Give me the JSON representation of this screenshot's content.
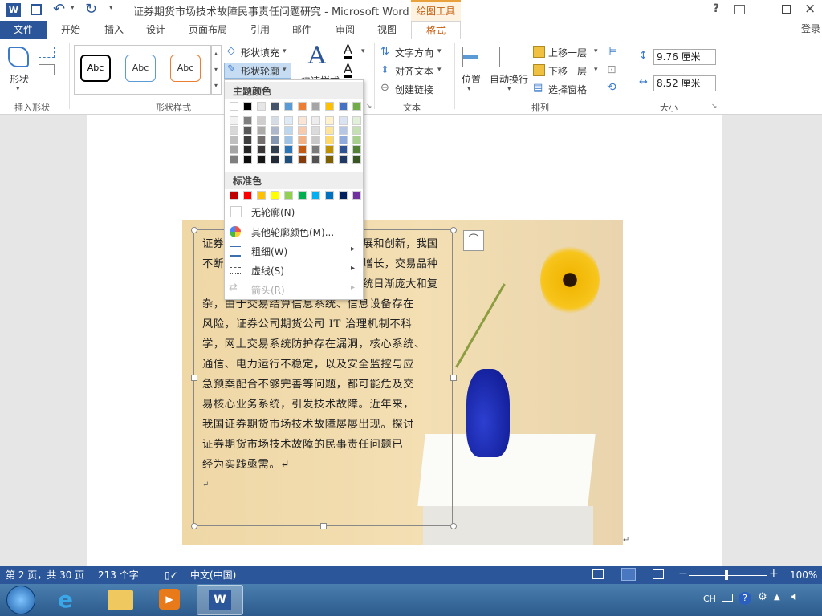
{
  "title": {
    "doc_title": "证券期货市场技术故障民事责任问题研究 - Microsoft Word",
    "context_tab": "绘图工具",
    "help": "?",
    "signin": "登录"
  },
  "tabs": [
    "文件",
    "开始",
    "插入",
    "设计",
    "页面布局",
    "引用",
    "邮件",
    "审阅",
    "视图",
    "格式"
  ],
  "ribbon": {
    "insert_shape": {
      "shape_label": "形状",
      "group": "插入形状"
    },
    "shape_styles": {
      "abc": [
        "Abc",
        "Abc",
        "Abc"
      ],
      "fill": "形状填充",
      "outline": "形状轮廓",
      "group": "形状样式"
    },
    "quick_styles": "快速样式",
    "text": {
      "direction": "文字方向",
      "align": "对齐文本",
      "link": "创建链接",
      "group": "文本"
    },
    "arrange": {
      "position": "位置",
      "wrap": "自动换行",
      "forward": "上移一层",
      "backward": "下移一层",
      "pane": "选择窗格",
      "group": "排列"
    },
    "size": {
      "height": "9.76 厘米",
      "width": "8.52 厘米",
      "group": "大小"
    }
  },
  "outline_menu": {
    "theme_colors_header": "主题颜色",
    "standard_colors_header": "标准色",
    "no_outline": "无轮廓(N)",
    "more_colors": "其他轮廓颜色(M)...",
    "weight": "粗细(W)",
    "dashes": "虚线(S)",
    "arrows": "箭头(R)",
    "theme_top_row": [
      "#ffffff",
      "#000000",
      "#e7e6e6",
      "#44546a",
      "#5b9bd5",
      "#ed7d31",
      "#a5a5a5",
      "#ffc000",
      "#4472c4",
      "#70ad47"
    ],
    "theme_shades": [
      [
        "#f2f2f2",
        "#7f7f7f",
        "#d0cece",
        "#d6dce4",
        "#deebf6",
        "#fbe5d5",
        "#ededed",
        "#fff2cc",
        "#dae3f3",
        "#e2efd9"
      ],
      [
        "#d8d8d8",
        "#595959",
        "#aeabab",
        "#adb9ca",
        "#bdd7ee",
        "#f8cbad",
        "#dbdbdb",
        "#fee599",
        "#b4c7e7",
        "#c5e0b3"
      ],
      [
        "#bfbfbf",
        "#3f3f3f",
        "#757070",
        "#8496b0",
        "#9dc3e6",
        "#f4b183",
        "#c9c9c9",
        "#ffd965",
        "#8faadc",
        "#a8d08d"
      ],
      [
        "#a5a5a5",
        "#262626",
        "#3a3838",
        "#323f4f",
        "#2e75b5",
        "#c55a11",
        "#7b7b7b",
        "#bf9000",
        "#2f5496",
        "#538135"
      ],
      [
        "#7f7f7f",
        "#0c0c0c",
        "#171616",
        "#222a35",
        "#1e4e79",
        "#843c0b",
        "#525252",
        "#7f6000",
        "#1f3864",
        "#375623"
      ]
    ],
    "standard": [
      "#c00000",
      "#ff0000",
      "#ffc000",
      "#ffff00",
      "#92d050",
      "#00b050",
      "#00b0f0",
      "#0070c0",
      "#002060",
      "#7030a0"
    ]
  },
  "document": {
    "partial_lines": [
      "展和创新，我国",
      "增长，交易品种",
      "统日渐庞大和复"
    ],
    "partial_prefix": [
      "证券",
      "不断"
    ],
    "lines": [
      "杂，由于交易结算信息系统、信息设备存在",
      "风险，证券公司期货公司 IT 治理机制不科",
      "学，网上交易系统防护存在漏洞，核心系统、",
      "通信、电力运行不稳定，以及安全监控与应",
      "急预案配合不够完善等问题，都可能危及交",
      "易核心业务系统，引发技术故障。近年来，",
      "我国证券期货市场技术故障屡屡出现。探讨",
      "证券期货市场技术故障的民事责任问题已",
      "经为实践亟需。↵"
    ],
    "para_mark": "↵"
  },
  "status": {
    "page": "第 2 页，共 30 页",
    "words": "213 个字",
    "lang": "中文(中国)",
    "zoom": "100%"
  },
  "taskbar": {
    "lang": "CH"
  }
}
